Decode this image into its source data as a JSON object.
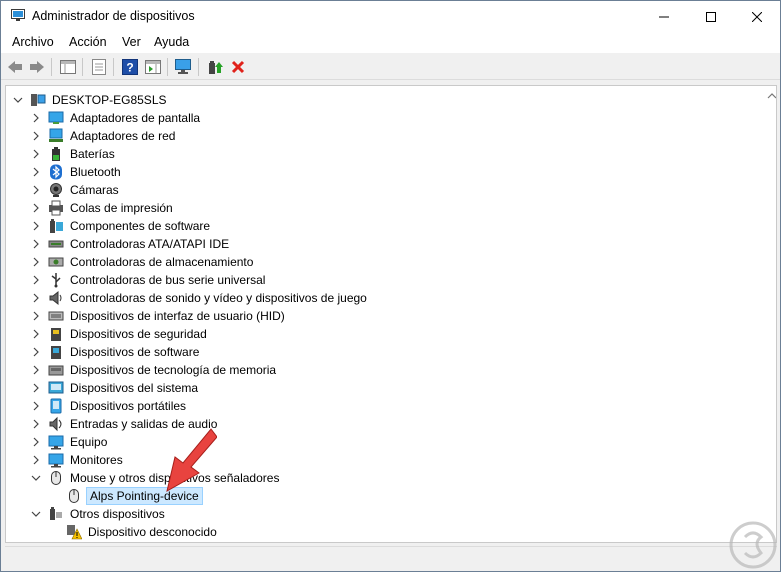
{
  "window": {
    "title": "Administrador de dispositivos"
  },
  "menu": {
    "items": [
      "Archivo",
      "Acción",
      "Ver",
      "Ayuda"
    ]
  },
  "tree": {
    "root": "DESKTOP-EG85SLS",
    "categories": [
      {
        "label": "Adaptadores de pantalla",
        "icon": "display-adapter-icon"
      },
      {
        "label": "Adaptadores de red",
        "icon": "network-adapter-icon"
      },
      {
        "label": "Baterías",
        "icon": "battery-icon"
      },
      {
        "label": "Bluetooth",
        "icon": "bluetooth-icon"
      },
      {
        "label": "Cámaras",
        "icon": "camera-icon"
      },
      {
        "label": "Colas de impresión",
        "icon": "printer-icon"
      },
      {
        "label": "Componentes de software",
        "icon": "software-component-icon"
      },
      {
        "label": "Controladoras ATA/ATAPI IDE",
        "icon": "ide-controller-icon"
      },
      {
        "label": "Controladoras de almacenamiento",
        "icon": "storage-controller-icon"
      },
      {
        "label": "Controladoras de bus serie universal",
        "icon": "usb-controller-icon"
      },
      {
        "label": "Controladoras de sonido y vídeo y dispositivos de juego",
        "icon": "speaker-icon"
      },
      {
        "label": "Dispositivos de interfaz de usuario (HID)",
        "icon": "hid-icon"
      },
      {
        "label": "Dispositivos de seguridad",
        "icon": "security-device-icon"
      },
      {
        "label": "Dispositivos de software",
        "icon": "software-device-icon"
      },
      {
        "label": "Dispositivos de tecnología de memoria",
        "icon": "memory-technology-icon"
      },
      {
        "label": "Dispositivos del sistema",
        "icon": "system-device-icon"
      },
      {
        "label": "Dispositivos portátiles",
        "icon": "portable-device-icon"
      },
      {
        "label": "Entradas y salidas de audio",
        "icon": "audio-io-icon"
      },
      {
        "label": "Equipo",
        "icon": "computer-icon"
      },
      {
        "label": "Monitores",
        "icon": "monitor-icon"
      }
    ],
    "mouse_category": {
      "label": "Mouse y otros dispositivos señaladores",
      "icon": "mouse-icon"
    },
    "mouse_child": {
      "label": "Alps Pointing-device",
      "icon": "mouse-icon"
    },
    "other_category": {
      "label": "Otros dispositivos",
      "icon": "other-devices-icon"
    },
    "other_child": {
      "label": "Dispositivo desconocido",
      "icon": "unknown-device-warning-icon"
    }
  },
  "colors": {
    "accent_arrow": "#e8433f",
    "selection_bg": "#cce8ff",
    "selection_border": "#99d1ff",
    "delete_red": "#e0221b"
  }
}
